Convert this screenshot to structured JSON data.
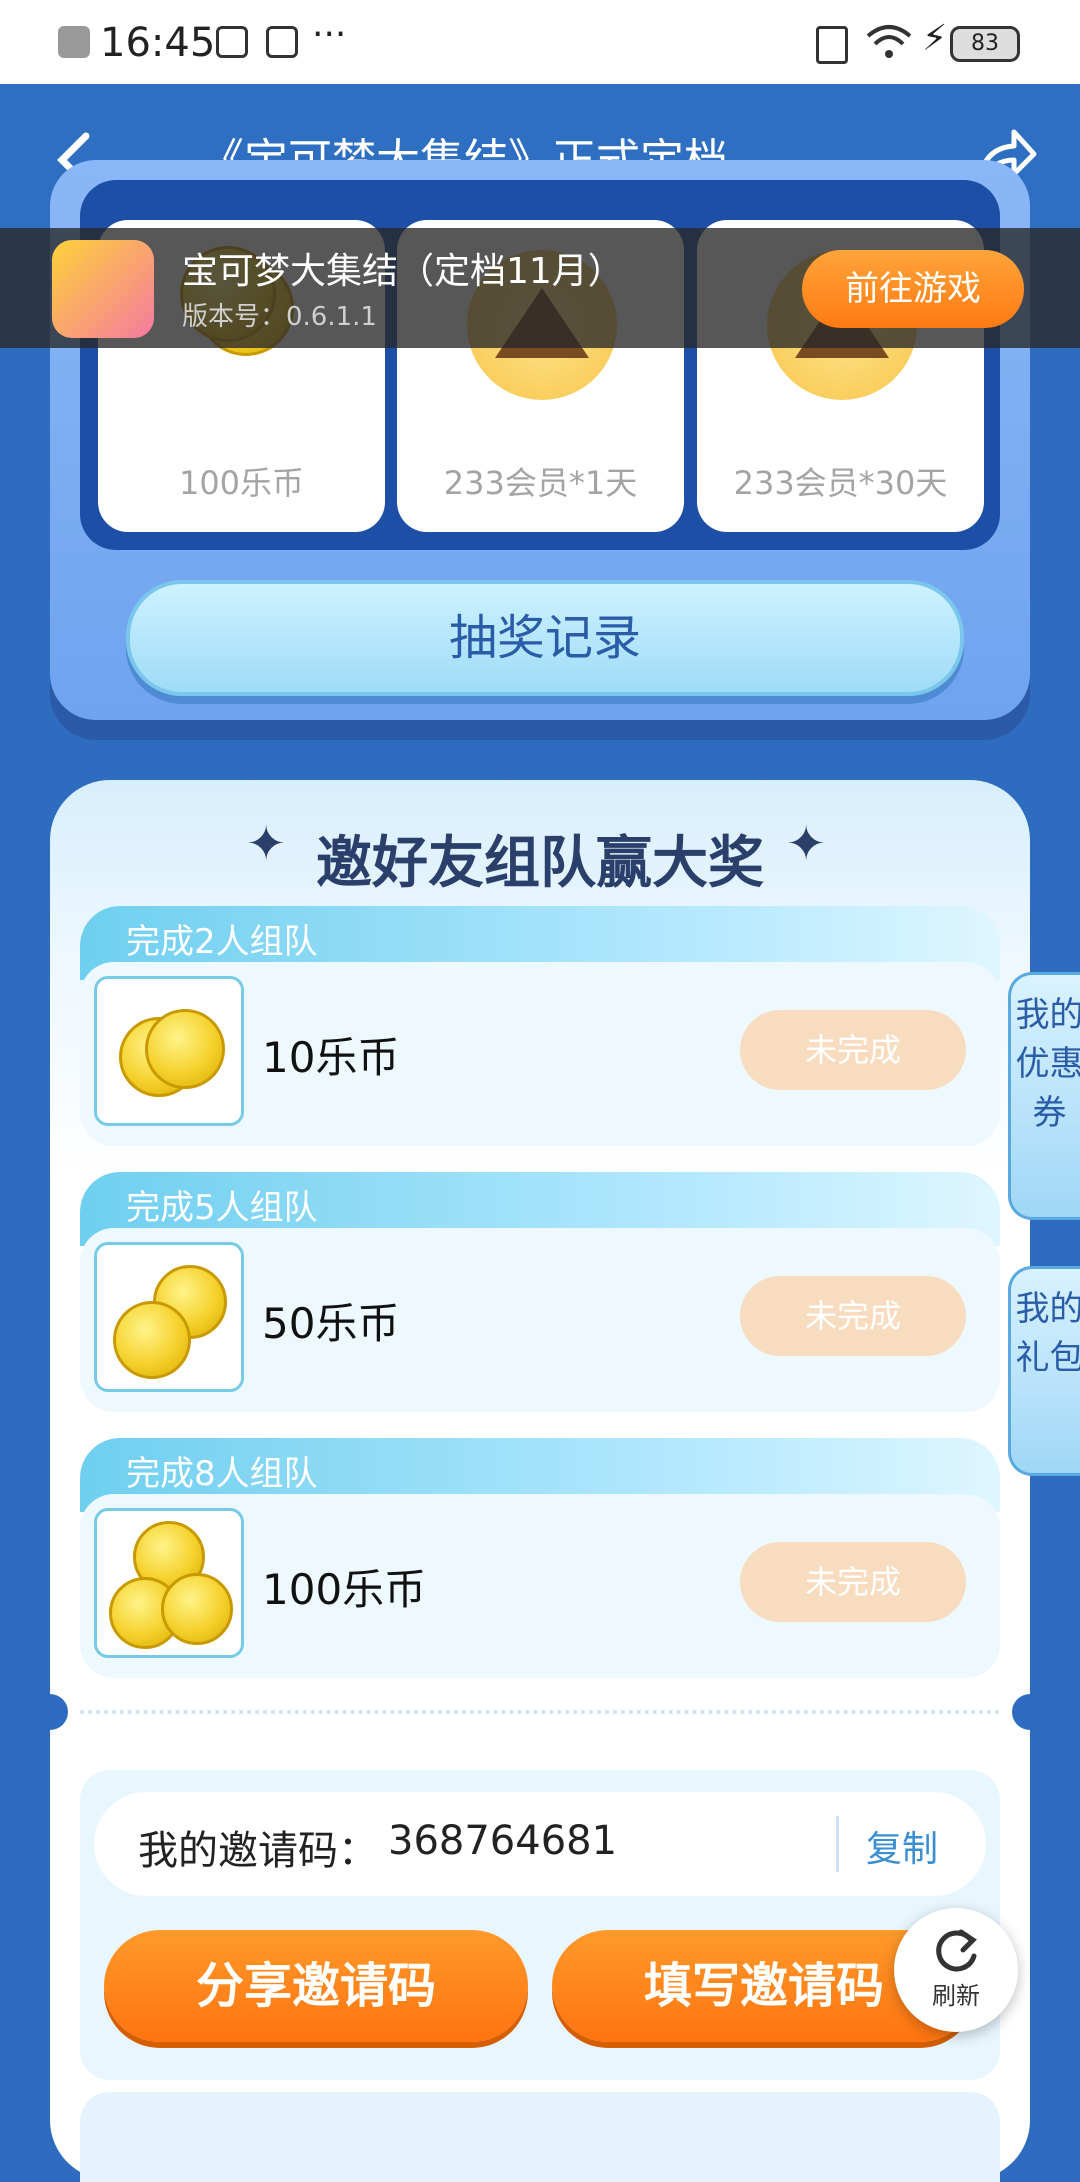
{
  "status_bar": {
    "time": "16:45",
    "battery": "83"
  },
  "nav": {
    "title": "《宝可梦大集结》正式定档，…"
  },
  "game": {
    "name": "宝可梦大集结（定档11月）",
    "version": "版本号：0.6.1.1",
    "go_label": "前往游戏"
  },
  "prizes": [
    {
      "label": "100乐币",
      "icon": "coins-icon"
    },
    {
      "label": "233会员*1天",
      "icon": "crown-icon"
    },
    {
      "label": "233会员*30天",
      "icon": "crown-icon"
    }
  ],
  "record_button": "抽奖记录",
  "invite": {
    "heading": "邀好友组队赢大奖",
    "tiers": [
      {
        "title": "完成2人组队",
        "reward": "10乐币",
        "status": "未完成"
      },
      {
        "title": "完成5人组队",
        "reward": "50乐币",
        "status": "未完成"
      },
      {
        "title": "完成8人组队",
        "reward": "100乐币",
        "status": "未完成"
      }
    ],
    "code_label": "我的邀请码：",
    "code_value": "368764681",
    "copy_label": "复制",
    "share_label": "分享邀请码",
    "fill_label": "填写邀请码"
  },
  "side_tabs": {
    "coupons": "我的优惠券",
    "gifts": "我的礼包"
  },
  "refresh_label": "刷新",
  "colors": {
    "accent_orange": "#ff7a12",
    "nav_blue": "#2f6fc2",
    "pending": "#f7dcc0"
  }
}
